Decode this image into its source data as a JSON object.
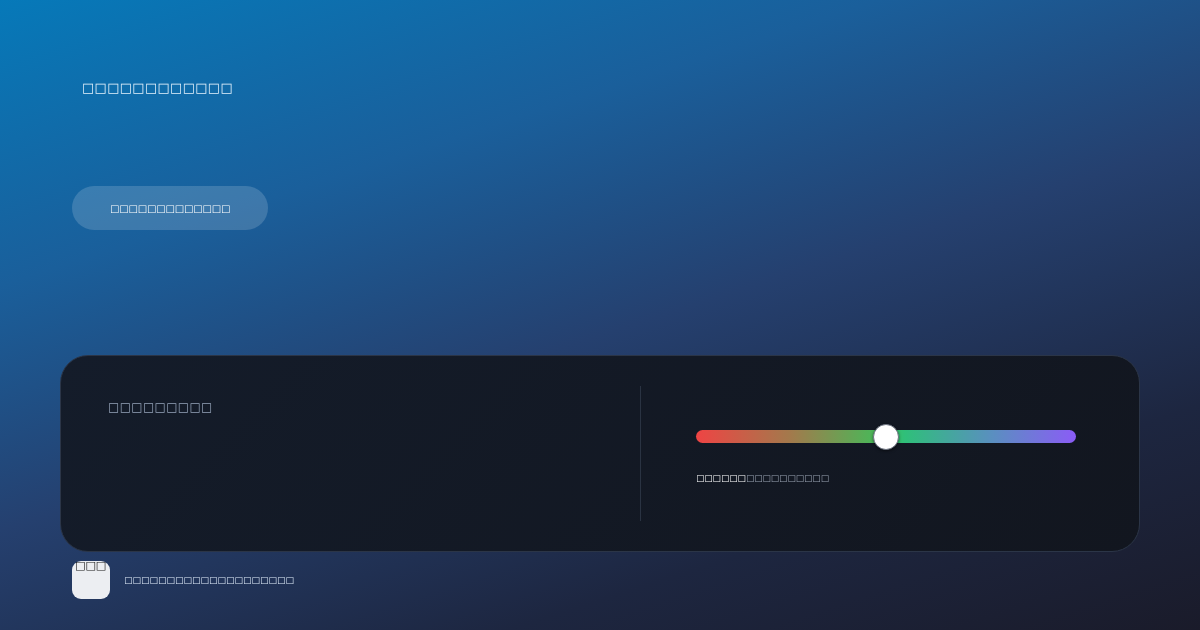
{
  "header": {
    "title": "□□□□□□□□□□□□",
    "button": "□□□□□□□□□□□□□"
  },
  "panel": {
    "label": "□□□□□□□□□",
    "slider": {
      "level": 0.5,
      "caption": "**□□□□□□**□□□□□□□□□□"
    }
  },
  "footer": {
    "tile_label": "□□□",
    "text": "□□□□□□□□□□□□□□□□□□□□"
  }
}
